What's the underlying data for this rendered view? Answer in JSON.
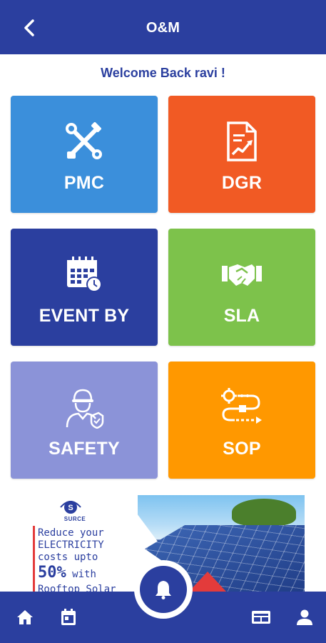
{
  "header": {
    "title": "O&M",
    "back_icon": "arrow-back-icon"
  },
  "welcome": "Welcome Back ravi !",
  "tiles": [
    {
      "label": "PMC",
      "icon": "tools-icon",
      "color": "#3b8fdb"
    },
    {
      "label": "DGR",
      "icon": "report-chart-icon",
      "color": "#f15a24"
    },
    {
      "label": "EVENT BY",
      "icon": "calendar-clock-icon",
      "color": "#2b3f9f"
    },
    {
      "label": "SLA",
      "icon": "handshake-icon",
      "color": "#7dc24b"
    },
    {
      "label": "SAFETY",
      "icon": "worker-shield-icon",
      "color": "#8b93d8"
    },
    {
      "label": "SOP",
      "icon": "process-flow-icon",
      "color": "#ff9800"
    }
  ],
  "banner": {
    "logo_text": "SURCE",
    "line1": "Reduce your",
    "line2": "ELECTRICITY",
    "line3": "costs upto",
    "percent": "50%",
    "with": " with",
    "line5": "Rooftop Solar"
  },
  "bottom_nav": {
    "home_icon": "home-icon",
    "calendar_icon": "calendar-icon",
    "bell_icon": "bell-icon",
    "card_icon": "id-card-icon",
    "profile_icon": "person-icon"
  },
  "colors": {
    "primary": "#2b3f9f"
  }
}
